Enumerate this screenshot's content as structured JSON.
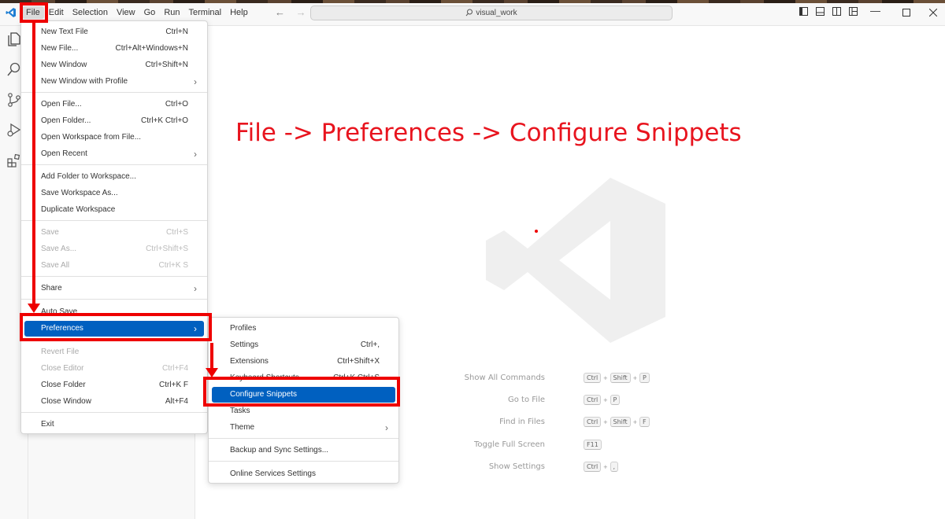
{
  "titlebar": {
    "search_text": "visual_work",
    "menus": [
      "File",
      "Edit",
      "Selection",
      "View",
      "Go",
      "Run",
      "Terminal",
      "Help"
    ]
  },
  "annotation": {
    "text": "File -> Preferences -> Configure Snippets",
    "color": "#e8141e"
  },
  "file_menu": {
    "items": [
      {
        "label": "New Text File",
        "shortcut": "Ctrl+N"
      },
      {
        "label": "New File...",
        "shortcut": "Ctrl+Alt+Windows+N"
      },
      {
        "label": "New Window",
        "shortcut": "Ctrl+Shift+N"
      },
      {
        "label": "New Window with Profile",
        "shortcut": ""
      },
      {
        "label": "Open File...",
        "shortcut": "Ctrl+O"
      },
      {
        "label": "Open Folder...",
        "shortcut": "Ctrl+K Ctrl+O"
      },
      {
        "label": "Open Workspace from File...",
        "shortcut": ""
      },
      {
        "label": "Open Recent",
        "shortcut": ""
      },
      {
        "label": "Add Folder to Workspace...",
        "shortcut": ""
      },
      {
        "label": "Save Workspace As...",
        "shortcut": ""
      },
      {
        "label": "Duplicate Workspace",
        "shortcut": ""
      },
      {
        "label": "Save",
        "shortcut": "Ctrl+S"
      },
      {
        "label": "Save As...",
        "shortcut": "Ctrl+Shift+S"
      },
      {
        "label": "Save All",
        "shortcut": "Ctrl+K S"
      },
      {
        "label": "Share",
        "shortcut": ""
      },
      {
        "label": "Auto Save",
        "shortcut": ""
      },
      {
        "label": "Preferences",
        "shortcut": ""
      },
      {
        "label": "Revert File",
        "shortcut": ""
      },
      {
        "label": "Close Editor",
        "shortcut": "Ctrl+F4"
      },
      {
        "label": "Close Folder",
        "shortcut": "Ctrl+K F"
      },
      {
        "label": "Close Window",
        "shortcut": "Alt+F4"
      },
      {
        "label": "Exit",
        "shortcut": ""
      }
    ]
  },
  "pref_menu": {
    "items": [
      {
        "label": "Profiles",
        "shortcut": ""
      },
      {
        "label": "Settings",
        "shortcut": "Ctrl+,"
      },
      {
        "label": "Extensions",
        "shortcut": "Ctrl+Shift+X"
      },
      {
        "label": "Keyboard Shortcuts",
        "shortcut": "Ctrl+K Ctrl+S"
      },
      {
        "label": "Configure Snippets",
        "shortcut": ""
      },
      {
        "label": "Tasks",
        "shortcut": ""
      },
      {
        "label": "Theme",
        "shortcut": ""
      },
      {
        "label": "Backup and Sync Settings...",
        "shortcut": ""
      },
      {
        "label": "Online Services Settings",
        "shortcut": ""
      }
    ]
  },
  "welcome_shortcuts": [
    {
      "label": "Show All Commands",
      "keys": [
        "Ctrl",
        "Shift",
        "P"
      ]
    },
    {
      "label": "Go to File",
      "keys": [
        "Ctrl",
        "P"
      ]
    },
    {
      "label": "Find in Files",
      "keys": [
        "Ctrl",
        "Shift",
        "F"
      ]
    },
    {
      "label": "Toggle Full Screen",
      "keys": [
        "F11"
      ]
    },
    {
      "label": "Show Settings",
      "keys": [
        "Ctrl",
        ","
      ]
    }
  ],
  "colors": {
    "accent": "#0060c0",
    "annotation_red": "#ee0000"
  }
}
